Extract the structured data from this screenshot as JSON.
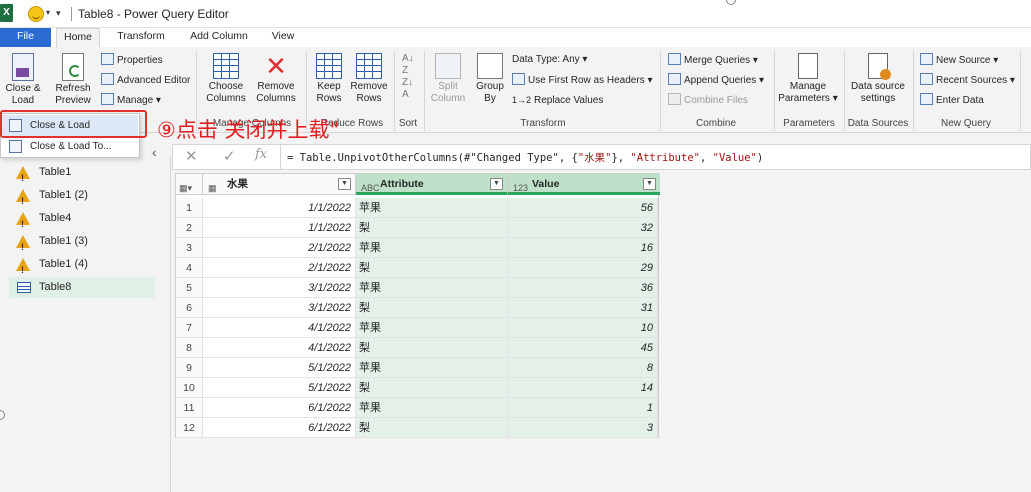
{
  "title_bar": {
    "title": "Table8 - Power Query Editor"
  },
  "tabs": [
    {
      "label": "File"
    },
    {
      "label": "Home"
    },
    {
      "label": "Transform"
    },
    {
      "label": "Add Column"
    },
    {
      "label": "View"
    }
  ],
  "ribbon": {
    "close_load_line1": "Close &",
    "close_load_line2": "Load",
    "refresh_line1": "Refresh",
    "refresh_line2": "Preview",
    "properties": "Properties",
    "advanced_editor": "Advanced Editor",
    "manage": "Manage",
    "choose_columns_line1": "Choose",
    "choose_columns_line2": "Columns",
    "remove_columns_line1": "Remove",
    "remove_columns_line2": "Columns",
    "manage_columns_group": "Manage Columns",
    "keep_rows_line1": "Keep",
    "keep_rows_line2": "Rows",
    "remove_rows_line1": "Remove",
    "remove_rows_line2": "Rows",
    "reduce_rows_group": "Reduce Rows",
    "sort_group": "Sort",
    "split_column_line1": "Split",
    "split_column_line2": "Column",
    "group_by_line1": "Group",
    "group_by_line2": "By",
    "data_type": "Data Type: Any",
    "use_first_row": "Use First Row as Headers",
    "replace_values": "Replace Values",
    "transform_group": "Transform",
    "merge_queries": "Merge Queries",
    "append_queries": "Append Queries",
    "combine_files": "Combine Files",
    "combine_group": "Combine",
    "manage_params_line1": "Manage",
    "manage_params_line2": "Parameters",
    "parameters_group": "Parameters",
    "ds_settings_line1": "Data source",
    "ds_settings_line2": "settings",
    "data_sources_group": "Data Sources",
    "new_source": "New Source",
    "recent_sources": "Recent Sources",
    "enter_data": "Enter Data",
    "new_query_group": "New Query"
  },
  "close_load_menu": {
    "close_and_load": "Close & Load",
    "close_and_load_to": "Close & Load To..."
  },
  "annotation": "⑨点击 关闭并上载\"",
  "formula_bar": {
    "prefix": "= Table.UnpivotOtherColumns(#\"Changed Type\", {",
    "s1": "\"水果\"",
    "mid": "}, ",
    "s2": "\"Attribute\"",
    "comma": ", ",
    "s3": "\"Value\"",
    "suffix": ")"
  },
  "queries": [
    {
      "name": "Table1",
      "warning": true
    },
    {
      "name": "Table1 (2)",
      "warning": true
    },
    {
      "name": "Table4",
      "warning": true
    },
    {
      "name": "Table1 (3)",
      "warning": true
    },
    {
      "name": "Table1 (4)",
      "warning": true
    },
    {
      "name": "Table8",
      "warning": false,
      "selected": true
    }
  ],
  "grid": {
    "columns": [
      {
        "name": "水果",
        "type_icon": "table-type-icon"
      },
      {
        "name": "Attribute",
        "type_icon": "ABC"
      },
      {
        "name": "Value",
        "type_icon": "123"
      }
    ],
    "rows": [
      {
        "n": "1",
        "date": "1/1/2022",
        "attr": "苹果",
        "value": "56"
      },
      {
        "n": "2",
        "date": "1/1/2022",
        "attr": "梨",
        "value": "32"
      },
      {
        "n": "3",
        "date": "2/1/2022",
        "attr": "苹果",
        "value": "16"
      },
      {
        "n": "4",
        "date": "2/1/2022",
        "attr": "梨",
        "value": "29"
      },
      {
        "n": "5",
        "date": "3/1/2022",
        "attr": "苹果",
        "value": "36"
      },
      {
        "n": "6",
        "date": "3/1/2022",
        "attr": "梨",
        "value": "31"
      },
      {
        "n": "7",
        "date": "4/1/2022",
        "attr": "苹果",
        "value": "10"
      },
      {
        "n": "8",
        "date": "4/1/2022",
        "attr": "梨",
        "value": "45"
      },
      {
        "n": "9",
        "date": "5/1/2022",
        "attr": "苹果",
        "value": "8"
      },
      {
        "n": "10",
        "date": "5/1/2022",
        "attr": "梨",
        "value": "14"
      },
      {
        "n": "11",
        "date": "6/1/2022",
        "attr": "苹果",
        "value": "1"
      },
      {
        "n": "12",
        "date": "6/1/2022",
        "attr": "梨",
        "value": "3"
      }
    ]
  },
  "colors": {
    "file_tab": "#2a6bd1",
    "selected_column": "#bfe0c9",
    "highlight_red": "#e02020"
  }
}
